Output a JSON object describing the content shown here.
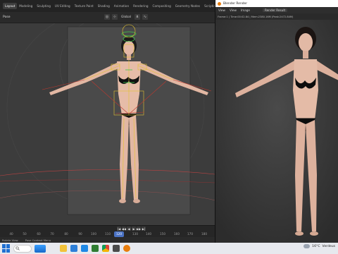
{
  "workspace_tabs": [
    "Layout",
    "Modeling",
    "Sculpting",
    "UV Editing",
    "Texture Paint",
    "Shading",
    "Animation",
    "Rendering",
    "Compositing",
    "Geometry Nodes",
    "Scripting"
  ],
  "workspace_add": "+",
  "viewport": {
    "mode_label": "Pose",
    "orientation_label": "Global"
  },
  "timeline": {
    "ticks": [
      "40",
      "50",
      "60",
      "70",
      "80",
      "90",
      "100",
      "110",
      "120",
      "130",
      "140",
      "150",
      "160",
      "170",
      "180"
    ],
    "current_frame": "120",
    "playback_buttons": [
      "|◀",
      "◀◀",
      "◀",
      "▶",
      "▶▶",
      "▶|"
    ]
  },
  "status_bar": {
    "items": [
      "Rotate View",
      "Pose Context Menu"
    ]
  },
  "render_window": {
    "title": "Blender Render",
    "menu": [
      "View",
      "View",
      "Image"
    ],
    "result_label": "Render Result",
    "status": "Frame:1 | Time:00:02.84 | Mem:2380.16M (Peak:2472.84M)"
  },
  "taskbar": {
    "temperature": "16°C",
    "condition": "Verdeus"
  },
  "colors": {
    "accent": "#4a72c4",
    "bone_yellow": "#e3c230",
    "bone_green": "#3ec84a",
    "ik_red": "#c0382e",
    "blender_orange": "#e87d0d"
  }
}
